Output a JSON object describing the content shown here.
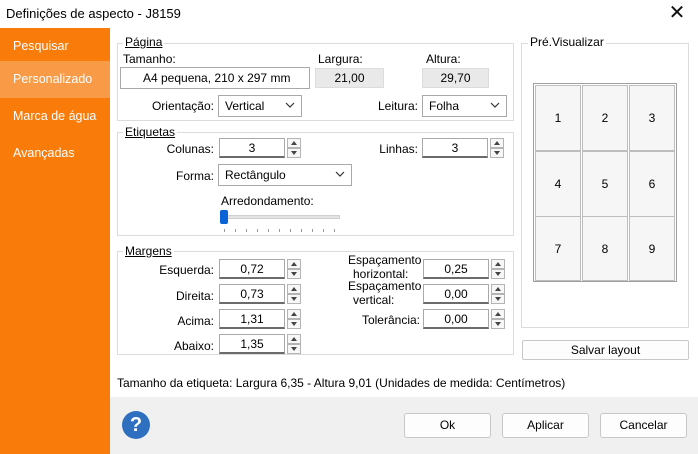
{
  "window": {
    "title": "Definições de aspecto - J8159",
    "close_glyph": "✕"
  },
  "sidebar": {
    "items": [
      {
        "label": "Pesquisar"
      },
      {
        "label": "Personalizado"
      },
      {
        "label": "Marca de água"
      },
      {
        "label": "Avançadas"
      }
    ]
  },
  "page_group": {
    "title": "Página",
    "size_label": "Tamanho:",
    "size_value": "A4 pequena, 210 x 297 mm",
    "width_label": "Largura:",
    "width_value": "21,00",
    "height_label": "Altura:",
    "height_value": "29,70",
    "orientation_label": "Orientação:",
    "orientation_value": "Vertical",
    "reading_label": "Leitura:",
    "reading_value": "Folha"
  },
  "labels_group": {
    "title": "Etiquetas",
    "columns_label": "Colunas:",
    "columns_value": "3",
    "rows_label": "Linhas:",
    "rows_value": "3",
    "shape_label": "Forma:",
    "shape_value": "Rectângulo",
    "rounding_label": "Arredondamento:",
    "rounding_level": 0
  },
  "margins_group": {
    "title": "Margens",
    "left_label": "Esquerda:",
    "left_value": "0,72",
    "right_label": "Direita:",
    "right_value": "0,73",
    "top_label": "Acima:",
    "top_value": "1,31",
    "bottom_label": "Abaixo:",
    "bottom_value": "1,35",
    "hspacing_label_1": "Espaçamento",
    "hspacing_label_2": "horizontal:",
    "hspacing_value": "0,25",
    "vspacing_label_1": "Espaçamento",
    "vspacing_label_2": "vertical:",
    "vspacing_value": "0,00",
    "tolerance_label": "Tolerância:",
    "tolerance_value": "0,00"
  },
  "preview": {
    "title": "Pré.Visualizar",
    "cells": [
      "1",
      "2",
      "3",
      "4",
      "5",
      "6",
      "7",
      "8",
      "9"
    ],
    "save_label": "Salvar layout"
  },
  "status_text": "Tamanho da etiqueta: Largura 6,35 - Altura 9,01 (Unidades de medida: Centímetros)",
  "footer": {
    "ok_label": "Ok",
    "apply_label": "Aplicar",
    "cancel_label": "Cancelar",
    "help_glyph": "?"
  },
  "colors": {
    "accent": "#f97b0a",
    "accent_active": "#f99a47",
    "help": "#2f6fbf"
  }
}
